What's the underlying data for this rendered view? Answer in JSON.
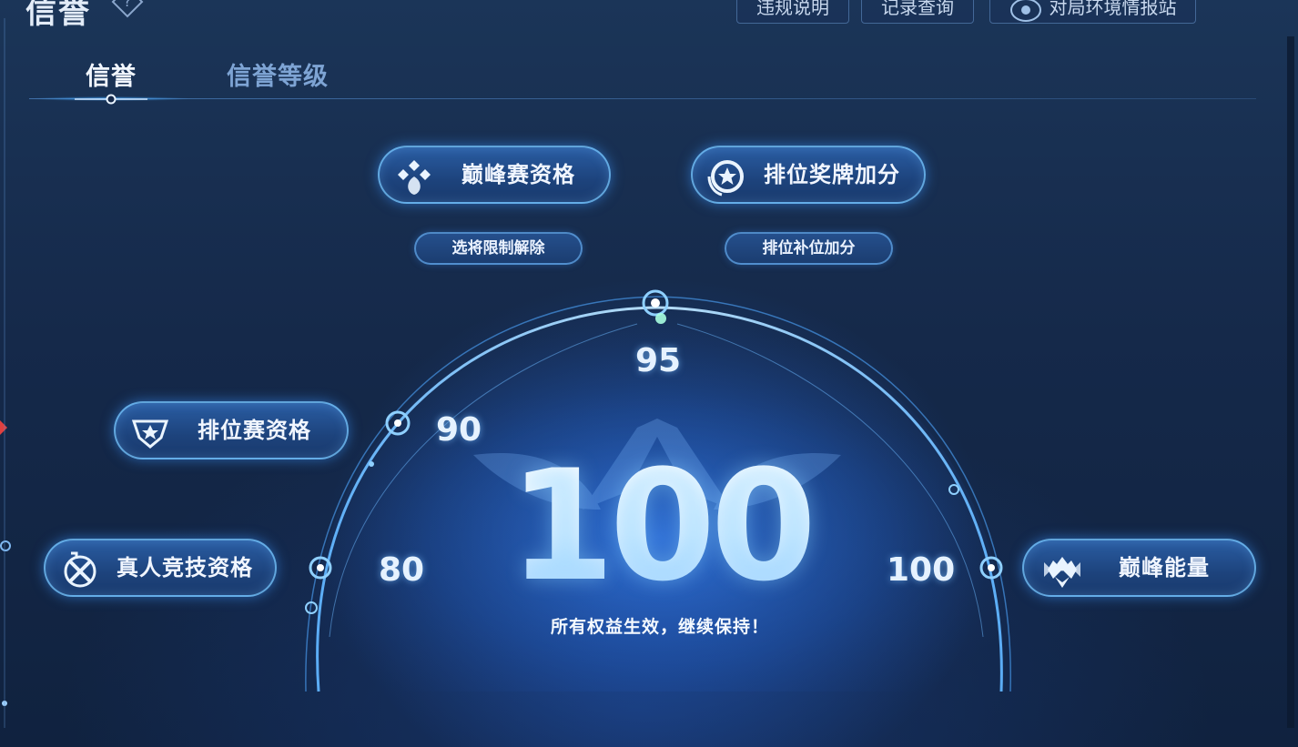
{
  "header": {
    "title": "信誉",
    "buttons": [
      {
        "label": "违规说明"
      },
      {
        "label": "记录查询"
      },
      {
        "label": "对局环境情报站"
      }
    ]
  },
  "tabs": [
    {
      "label": "信誉",
      "active": true
    },
    {
      "label": "信誉等级",
      "active": false
    }
  ],
  "benefits": {
    "peak_qualification": {
      "label": "巅峰赛资格",
      "icon": "peak-match-icon",
      "sub_label": "选将限制解除"
    },
    "ranked_medal_bonus": {
      "label": "排位奖牌加分",
      "icon": "medal-star-icon",
      "sub_label": "排位补位加分"
    },
    "ranked_qualification": {
      "label": "排位赛资格",
      "icon": "ranked-badge-icon"
    },
    "pvp_qualification": {
      "label": "真人竞技资格",
      "icon": "swords-icon"
    },
    "peak_energy": {
      "label": "巅峰能量",
      "icon": "peak-energy-icon"
    }
  },
  "thresholds": [
    {
      "label": "80"
    },
    {
      "label": "90"
    },
    {
      "label": "95"
    },
    {
      "label": "100"
    }
  ],
  "score": {
    "value": "100",
    "status": "所有权益生效，继续保持！"
  },
  "colors": {
    "background": "#15294a",
    "accent": "#3aa0ff",
    "pill_border": "#78c8ff",
    "text": "#f1f6ff",
    "inactive_tab": "#7ea4d4"
  }
}
